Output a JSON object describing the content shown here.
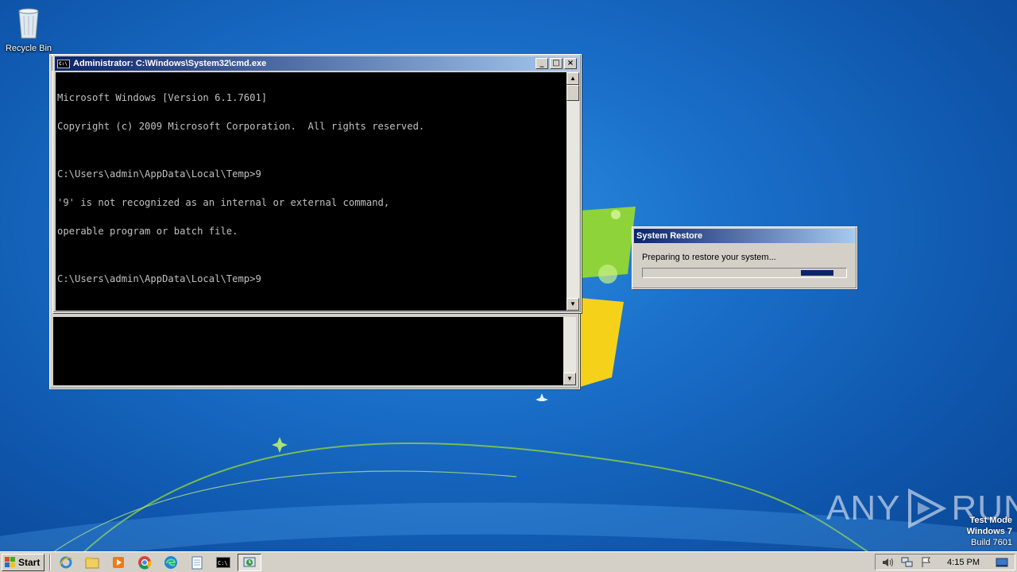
{
  "desktop": {
    "recycle_bin_label": "Recycle Bin"
  },
  "cmd_window": {
    "title": "Administrator: C:\\Windows\\System32\\cmd.exe",
    "icon_text": "C:\\",
    "console_lines": [
      "Microsoft Windows [Version 6.1.7601]",
      "Copyright (c) 2009 Microsoft Corporation.  All rights reserved.",
      "",
      "C:\\Users\\admin\\AppData\\Local\\Temp>9",
      "'9' is not recognized as an internal or external command,",
      "operable program or batch file.",
      "",
      "C:\\Users\\admin\\AppData\\Local\\Temp>9"
    ],
    "minimize_label": "_",
    "maximize_label": "□",
    "close_label": "×"
  },
  "system_restore": {
    "title": "System Restore",
    "message": "Preparing to restore your system...",
    "progress_fraction": 0.16
  },
  "watermark": {
    "left": "ANY",
    "right": "RUN"
  },
  "test_mode": {
    "line1": "Test Mode",
    "line2": "Windows 7",
    "line3": "Build 7601"
  },
  "taskbar": {
    "start_label": "Start",
    "clock": "4:15 PM",
    "pinned": [
      "ie-icon",
      "explorer-icon",
      "media-player-icon",
      "chrome-icon",
      "edge-icon",
      "notepad-icon",
      "cmd-icon",
      "restore-icon"
    ]
  },
  "colors": {
    "active_title": "#0a246a",
    "console_bg": "#000000",
    "console_fg": "#c0c0c0"
  }
}
